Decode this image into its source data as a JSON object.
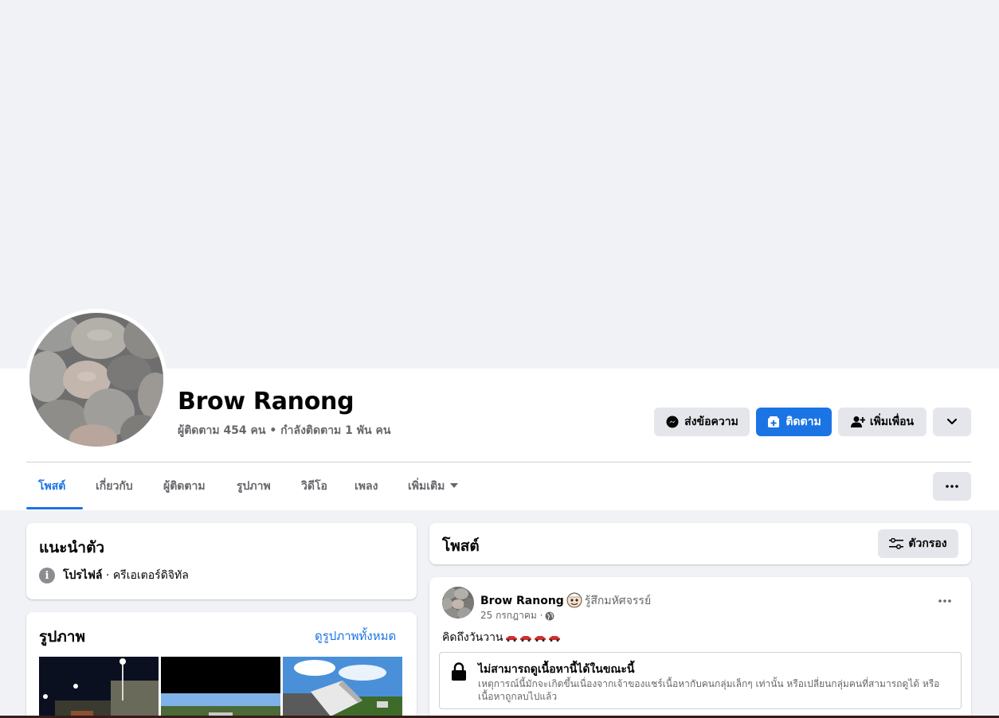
{
  "profile": {
    "name": "Brow Ranong",
    "stats": "ผู้ติดตาม 454 คน • กำลังติดตาม 1 พัน คน"
  },
  "actions": {
    "message": "ส่งข้อความ",
    "follow": "ติดตาม",
    "add_friend": "เพิ่มเพื่อน"
  },
  "tabs": [
    {
      "label": "โพสต์",
      "active": true
    },
    {
      "label": "เกี่ยวกับ"
    },
    {
      "label": "ผู้ติดตาม"
    },
    {
      "label": "รูปภาพ"
    },
    {
      "label": "วิดีโอ"
    },
    {
      "label": "เพลง"
    },
    {
      "label": "เพิ่มเติม"
    }
  ],
  "intro": {
    "title": "แนะนำตัว",
    "profile_label": "โปรไฟล์",
    "profile_desc": " · ครีเอเตอร์ดิจิทัล"
  },
  "photos": {
    "title": "รูปภาพ",
    "see_all": "ดูรูปภาพทั้งหมด"
  },
  "posts_header": {
    "title": "โพสต์",
    "filter": "ตัวกรอง"
  },
  "post": {
    "author": "Brow Ranong",
    "feeling": "รู้สึกมหัศจรรย์",
    "time": "25 กรกฎาคม ·",
    "text": "คิดถึงวันวาน",
    "unavailable_title": "ไม่สามารถดูเนื้อหานี้ได้ในขณะนี้",
    "unavailable_body": "เหตุการณ์นี้มักจะเกิดขึ้นเนื่องจากเจ้าของแชร์เนื้อหากับคนกลุ่มเล็กๆ เท่านั้น หรือเปลี่ยนกลุ่มคนที่สามารถดูได้ หรือเนื้อหาถูกลบไปแล้ว"
  },
  "colors": {
    "accent": "#1b74e4",
    "background": "#f0f2f5",
    "secondary_text": "#65676b"
  }
}
